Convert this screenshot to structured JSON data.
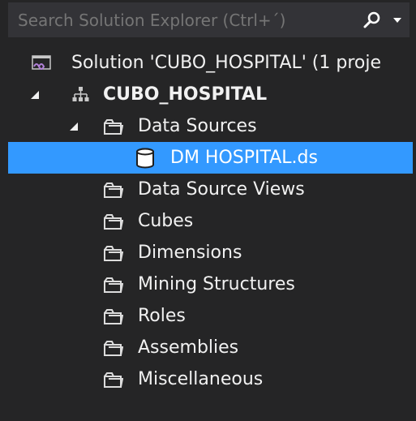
{
  "search": {
    "placeholder": "Search Solution Explorer (Ctrl+´)"
  },
  "tree": {
    "solution": {
      "label": "Solution 'CUBO_HOSPITAL' (1 proje",
      "icon": "solution-icon"
    },
    "project": {
      "label": "CUBO_HOSPITAL",
      "icon": "project-icon"
    },
    "data_sources": {
      "label": "Data Sources",
      "icon": "folder-icon"
    },
    "dm_hospital": {
      "label": "DM HOSPITAL.ds",
      "icon": "datasource-icon"
    },
    "folders": [
      {
        "label": "Data Source Views",
        "icon": "folder-icon"
      },
      {
        "label": "Cubes",
        "icon": "folder-icon"
      },
      {
        "label": "Dimensions",
        "icon": "folder-icon"
      },
      {
        "label": "Mining Structures",
        "icon": "folder-icon"
      },
      {
        "label": "Roles",
        "icon": "folder-icon"
      },
      {
        "label": "Assemblies",
        "icon": "folder-icon"
      },
      {
        "label": "Miscellaneous",
        "icon": "folder-icon"
      }
    ]
  },
  "colors": {
    "background": "#252526",
    "search_background": "#333337",
    "selection": "#3399ff",
    "text": "#f1f1f1",
    "placeholder": "#9e9e9e"
  }
}
